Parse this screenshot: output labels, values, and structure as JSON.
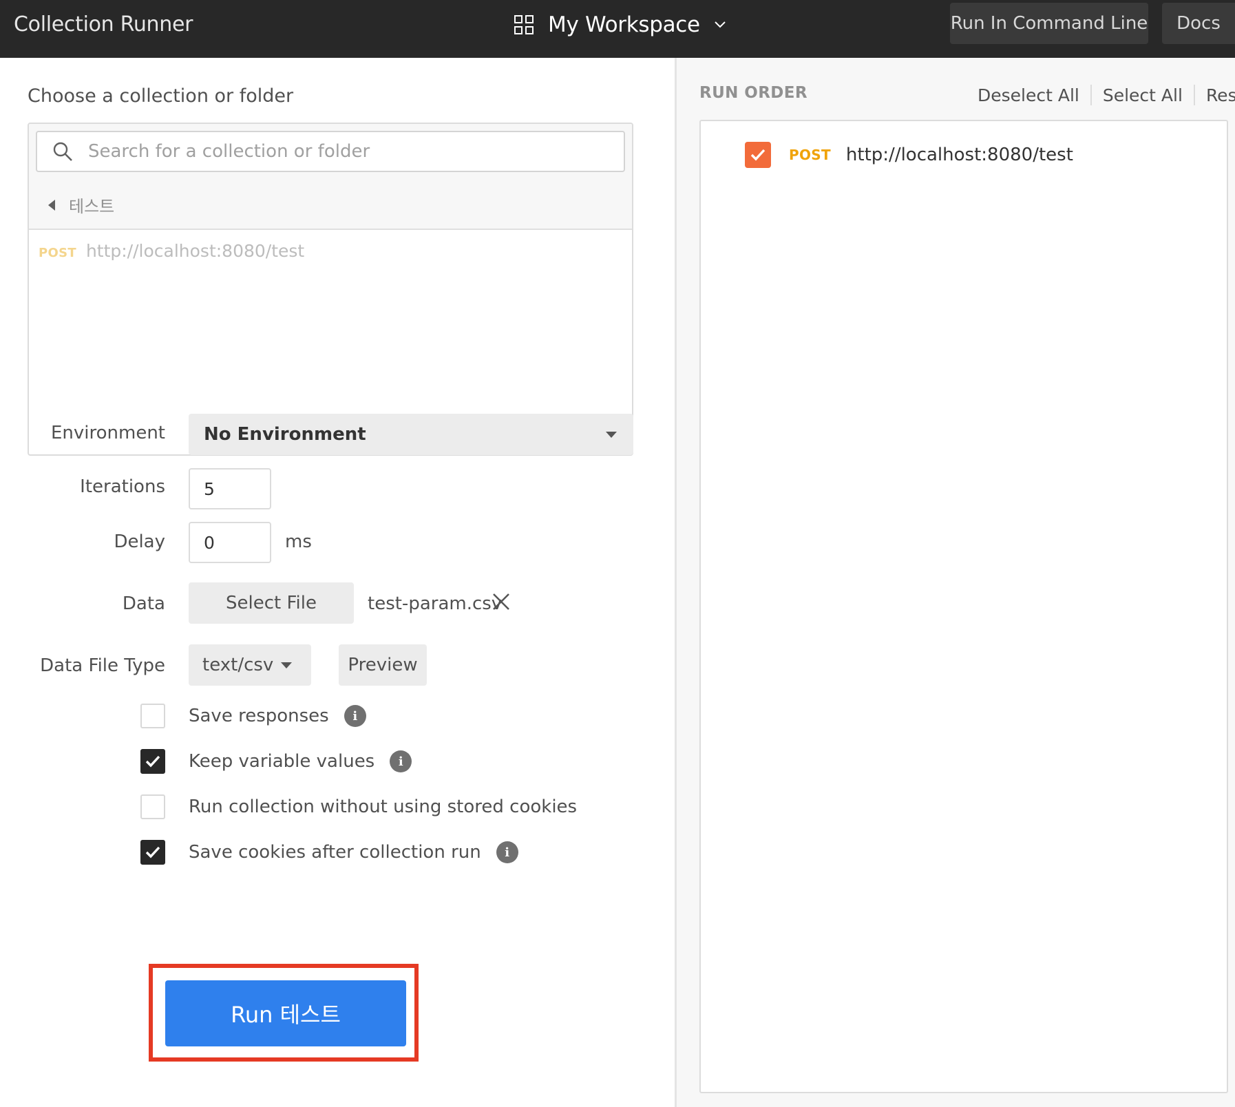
{
  "header": {
    "title": "Collection Runner",
    "workspace": "My Workspace",
    "run_in_command_line": "Run In Command Line",
    "docs": "Docs"
  },
  "collection": {
    "heading": "Choose a collection or folder",
    "search_placeholder": "Search for a collection or folder",
    "folder": "테스트",
    "requests": [
      {
        "method": "POST",
        "url": "http://localhost:8080/test"
      }
    ]
  },
  "form": {
    "environment_label": "Environment",
    "environment_value": "No Environment",
    "iterations_label": "Iterations",
    "iterations_value": "5",
    "delay_label": "Delay",
    "delay_value": "0",
    "delay_unit": "ms",
    "data_label": "Data",
    "select_file": "Select File",
    "file_name": "test-param.csv",
    "data_file_type_label": "Data File Type",
    "data_file_type_value": "text/csv",
    "preview": "Preview"
  },
  "options": [
    {
      "label": "Save responses",
      "checked": false,
      "info": true
    },
    {
      "label": "Keep variable values",
      "checked": true,
      "info": true
    },
    {
      "label": "Run collection without using stored cookies",
      "checked": false,
      "info": false
    },
    {
      "label": "Save cookies after collection run",
      "checked": true,
      "info": true
    }
  ],
  "run_button": "Run 테스트",
  "run_order": {
    "heading": "RUN ORDER",
    "deselect_all": "Deselect All",
    "select_all": "Select All",
    "reset": "Reset",
    "items": [
      {
        "method": "POST",
        "url": "http://localhost:8080/test",
        "checked": true
      }
    ]
  },
  "colors": {
    "accent_blue": "#2f80ed",
    "highlight_red": "#e53a24",
    "post_orange": "#f0a30a",
    "checkbox_orange": "#f26b3a",
    "topbar": "#282828"
  }
}
